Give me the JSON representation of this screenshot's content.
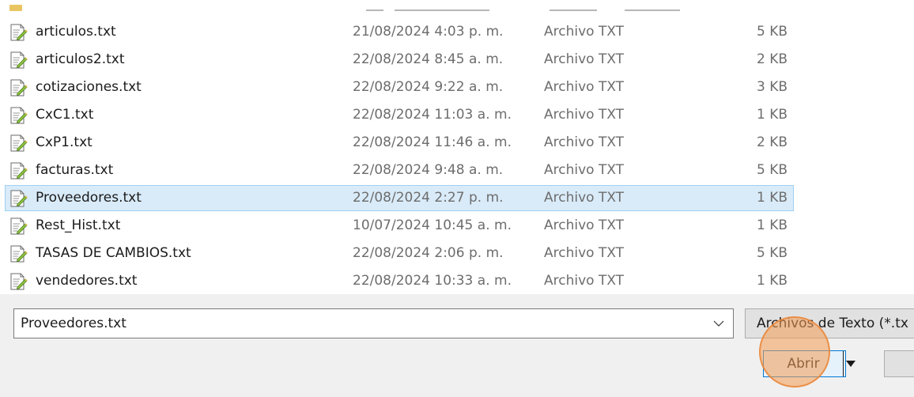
{
  "file_list": {
    "rows": [
      {
        "name": "articulos.txt",
        "date": "21/08/2024 4:03 p. m.",
        "type": "Archivo TXT",
        "size": "5 KB",
        "selected": false
      },
      {
        "name": "articulos2.txt",
        "date": "22/08/2024 8:45 a. m.",
        "type": "Archivo TXT",
        "size": "2 KB",
        "selected": false
      },
      {
        "name": "cotizaciones.txt",
        "date": "22/08/2024 9:22 a. m.",
        "type": "Archivo TXT",
        "size": "3 KB",
        "selected": false
      },
      {
        "name": "CxC1.txt",
        "date": "22/08/2024 11:03 a. m.",
        "type": "Archivo TXT",
        "size": "1 KB",
        "selected": false
      },
      {
        "name": "CxP1.txt",
        "date": "22/08/2024 11:46 a. m.",
        "type": "Archivo TXT",
        "size": "2 KB",
        "selected": false
      },
      {
        "name": "facturas.txt",
        "date": "22/08/2024 9:48 a. m.",
        "type": "Archivo TXT",
        "size": "5 KB",
        "selected": false
      },
      {
        "name": "Proveedores.txt",
        "date": "22/08/2024 2:27 p. m.",
        "type": "Archivo TXT",
        "size": "1 KB",
        "selected": true
      },
      {
        "name": "Rest_Hist.txt",
        "date": "10/07/2024 10:45 a. m.",
        "type": "Archivo TXT",
        "size": "1 KB",
        "selected": false
      },
      {
        "name": "TASAS DE CAMBIOS.txt",
        "date": "22/08/2024 2:06 p. m.",
        "type": "Archivo TXT",
        "size": "5 KB",
        "selected": false
      },
      {
        "name": "vendedores.txt",
        "date": "22/08/2024 10:33 a. m.",
        "type": "Archivo TXT",
        "size": "1 KB",
        "selected": false
      }
    ],
    "row_icon": "text-file-icon",
    "partial_row_icon": "folder-icon"
  },
  "bottom_panel": {
    "file_name_value": "Proveedores.txt",
    "file_type_label": "Archivos de Texto (*.tx",
    "open_label": "Abrir"
  },
  "colors": {
    "selection_bg": "#d9ebf9",
    "selection_border": "#9ed0f2",
    "secondary_text": "#6d6d6d",
    "panel_bg": "#f0f0f0",
    "accent_border": "#0078d7",
    "click_highlight": "#f49d54"
  }
}
